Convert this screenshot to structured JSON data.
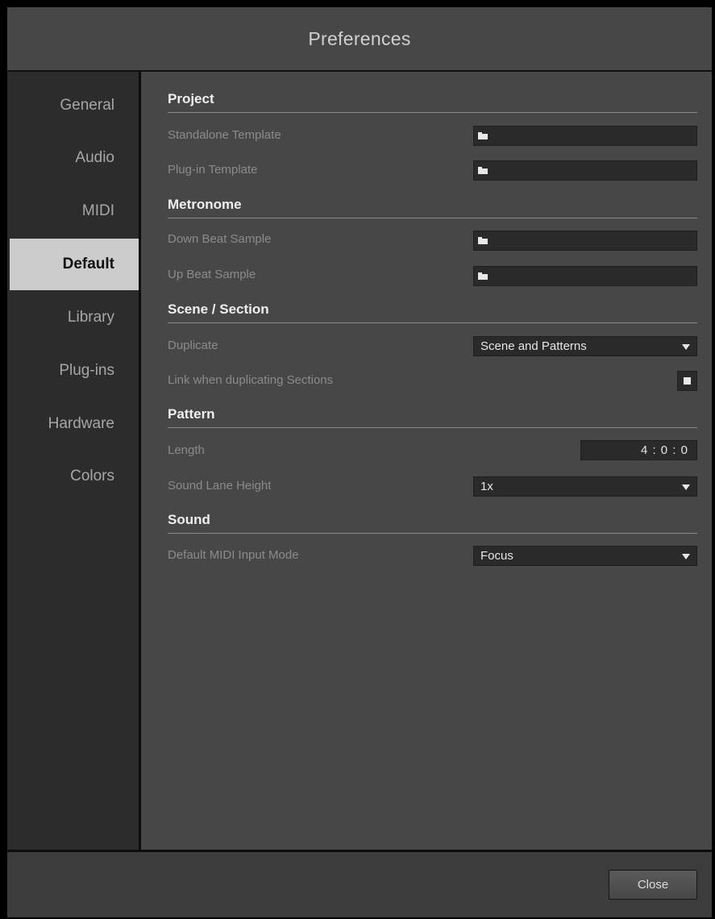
{
  "window": {
    "title": "Preferences"
  },
  "sidebar": {
    "items": [
      {
        "label": "General",
        "active": false
      },
      {
        "label": "Audio",
        "active": false
      },
      {
        "label": "MIDI",
        "active": false
      },
      {
        "label": "Default",
        "active": true
      },
      {
        "label": "Library",
        "active": false
      },
      {
        "label": "Plug-ins",
        "active": false
      },
      {
        "label": "Hardware",
        "active": false
      },
      {
        "label": "Colors",
        "active": false
      }
    ]
  },
  "sections": {
    "project": {
      "title": "Project",
      "standalone_template_label": "Standalone Template",
      "plugin_template_label": "Plug-in Template"
    },
    "metronome": {
      "title": "Metronome",
      "down_beat_label": "Down Beat Sample",
      "up_beat_label": "Up Beat Sample"
    },
    "scene_section": {
      "title": "Scene / Section",
      "duplicate_label": "Duplicate",
      "duplicate_value": "Scene and Patterns",
      "link_label": "Link when duplicating Sections",
      "link_checked": true
    },
    "pattern": {
      "title": "Pattern",
      "length_label": "Length",
      "length_value": "4 : 0 : 0",
      "lane_height_label": "Sound Lane Height",
      "lane_height_value": "1x"
    },
    "sound": {
      "title": "Sound",
      "midi_mode_label": "Default MIDI Input Mode",
      "midi_mode_value": "Focus"
    }
  },
  "footer": {
    "close_label": "Close"
  },
  "icons": {
    "folder": "folder-icon",
    "dropdown": "chevron-down-icon",
    "checkbox": "checkbox-checked-icon"
  },
  "colors": {
    "active_tab_bg": "#cccccc",
    "panel_bg": "#474747",
    "sidebar_bg": "#2c2c2c",
    "field_bg": "#2a2a2a"
  }
}
